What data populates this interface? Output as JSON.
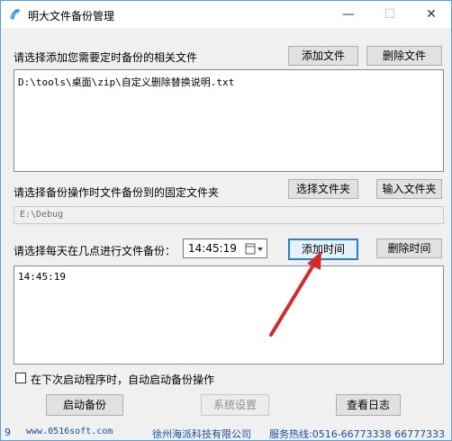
{
  "window": {
    "title": "明大文件备份管理",
    "minimize_glyph": "—",
    "maximize_glyph": "☐",
    "close_glyph": "✕"
  },
  "files_section": {
    "label": "请选择添加您需要定时备份的相关文件",
    "add_file_button": "添加文件",
    "delete_file_button": "删除文件",
    "files": [
      "D:\\tools\\桌面\\zip\\自定义删除替换说明.txt"
    ]
  },
  "folder_section": {
    "label": "请选择备份操作时文件备份到的固定文件夹",
    "select_folder_button": "选择文件夹",
    "input_folder_button": "输入文件夹",
    "folder_path": "E:\\Debug"
  },
  "time_section": {
    "label": "请选择每天在几点进行文件备份：",
    "time_value": "14:45:19",
    "add_time_button": "添加时间",
    "delete_time_button": "删除时间",
    "times": [
      "14:45:19"
    ]
  },
  "autostart": {
    "label": "在下次启动程序时，自动启动备份操作",
    "checked": false
  },
  "actions": {
    "start_backup": "启动备份",
    "system_settings": "系统设置",
    "view_log": "查看日志"
  },
  "footer": {
    "version": "9",
    "website": "www.0516soft.com",
    "company": "徐州海派科技有限公司",
    "hotline": "服务热线:0516-66773338 66777333"
  },
  "annotation": {
    "arrow_color": "#d42a2a"
  }
}
